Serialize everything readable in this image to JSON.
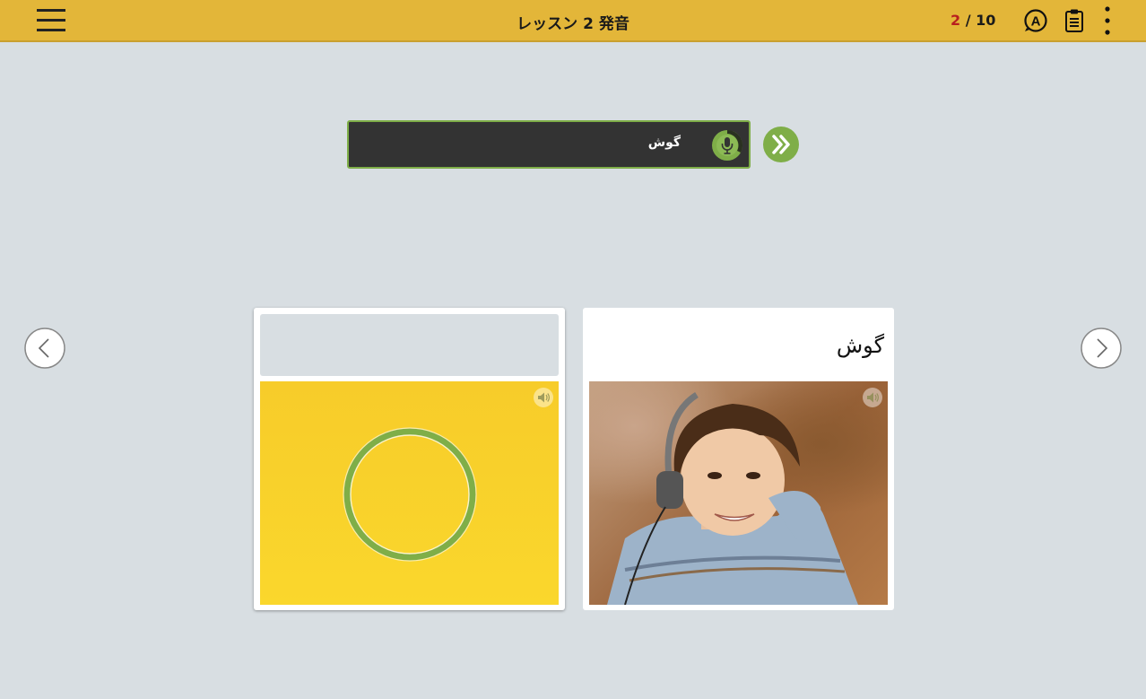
{
  "header": {
    "title": "レッスン 2 発音",
    "progress_current": "2",
    "progress_sep": " / ",
    "progress_total": "10",
    "background_color": "#e3b639"
  },
  "prompt": {
    "text": "گوش",
    "border_color": "#7fae48"
  },
  "cards": {
    "left": {
      "label": "",
      "image": "yellow-circle-image"
    },
    "right": {
      "label": "گوش",
      "image": "boy-with-headphones-photo"
    }
  },
  "icons": {
    "menu": "hamburger-menu-icon",
    "answer": "circle-a-icon",
    "notes": "clipboard-icon",
    "more": "vertical-dots-icon",
    "mic": "microphone-icon",
    "next": "double-chevron-right-icon",
    "prev_nav": "chevron-left-icon",
    "next_nav": "chevron-right-icon",
    "speaker": "speaker-icon"
  },
  "colors": {
    "accent_green": "#7fae48",
    "progress_current": "#b81f1f",
    "background": "#d8dee2"
  }
}
